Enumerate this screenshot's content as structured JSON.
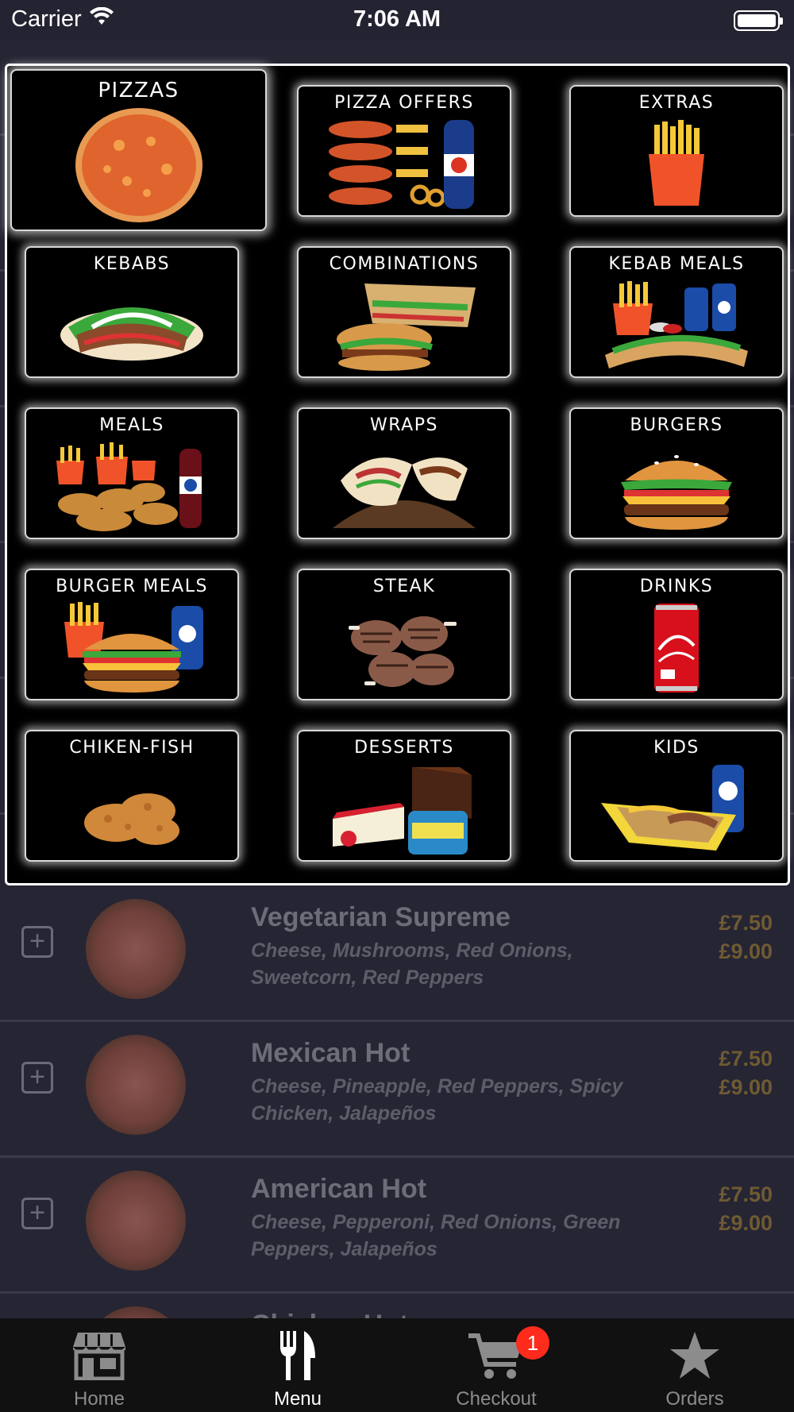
{
  "status_bar": {
    "carrier": "Carrier",
    "time": "7:06 AM"
  },
  "menu_categories": [
    {
      "label": "PIZZAS",
      "icon": "pizza-icon"
    },
    {
      "label": "PIZZA OFFERS",
      "icon": "pizza-offers-icon"
    },
    {
      "label": "EXTRAS",
      "icon": "fries-icon"
    },
    {
      "label": "KEBABS",
      "icon": "kebab-icon"
    },
    {
      "label": "COMBINATIONS",
      "icon": "combination-icon"
    },
    {
      "label": "KEBAB MEALS",
      "icon": "kebab-meal-icon"
    },
    {
      "label": "MEALS",
      "icon": "chicken-meal-icon"
    },
    {
      "label": "WRAPS",
      "icon": "wrap-icon"
    },
    {
      "label": "BURGERS",
      "icon": "burger-icon"
    },
    {
      "label": "BURGER MEALS",
      "icon": "burger-meal-icon"
    },
    {
      "label": "STEAK",
      "icon": "steak-icon"
    },
    {
      "label": "DRINKS",
      "icon": "cola-can-icon"
    },
    {
      "label": "CHIKEN-FISH",
      "icon": "fried-chicken-icon"
    },
    {
      "label": "DESSERTS",
      "icon": "dessert-icon"
    },
    {
      "label": "KIDS",
      "icon": "kids-meal-icon"
    }
  ],
  "menu_items": [
    {
      "name": "Vegetarian Supreme",
      "description": "Cheese, Mushrooms, Red Onions, Sweetcorn, Red Peppers",
      "prices": [
        "£7.50",
        "£9.00"
      ]
    },
    {
      "name": "Mexican Hot",
      "description": "Cheese, Pineapple, Red Peppers, Spicy Chicken, Jalapeños",
      "prices": [
        "£7.50",
        "£9.00"
      ]
    },
    {
      "name": "American Hot",
      "description": "Cheese, Pepperoni, Red Onions, Green Peppers, Jalapeños",
      "prices": [
        "£7.50",
        "£9.00"
      ]
    },
    {
      "name": "Chicken Hot",
      "description": "",
      "prices": []
    }
  ],
  "tab_bar": {
    "home": "Home",
    "menu": "Menu",
    "checkout": "Checkout",
    "checkout_badge": "1",
    "orders": "Orders"
  },
  "colors": {
    "accent_badge": "#ff2b1c",
    "price": "#6f5a32"
  }
}
